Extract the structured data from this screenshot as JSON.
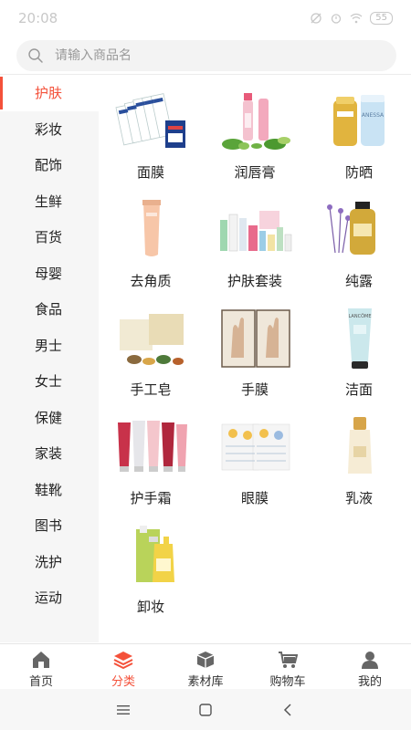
{
  "status_bar": {
    "time": "20:08",
    "battery": "55"
  },
  "search": {
    "placeholder": "请输入商品名"
  },
  "sidebar": {
    "items": [
      {
        "label": "护肤",
        "active": true
      },
      {
        "label": "彩妆"
      },
      {
        "label": "配饰"
      },
      {
        "label": "生鲜"
      },
      {
        "label": "百货"
      },
      {
        "label": "母婴"
      },
      {
        "label": "食品"
      },
      {
        "label": "男士"
      },
      {
        "label": "女士"
      },
      {
        "label": "保健"
      },
      {
        "label": "家装"
      },
      {
        "label": "鞋靴"
      },
      {
        "label": "图书"
      },
      {
        "label": "洗护"
      },
      {
        "label": "运动"
      }
    ]
  },
  "categories": [
    {
      "label": "面膜",
      "icon": "face-mask-product-image"
    },
    {
      "label": "润唇膏",
      "icon": "lip-balm-product-image"
    },
    {
      "label": "防晒",
      "icon": "sunscreen-product-image"
    },
    {
      "label": "去角质",
      "icon": "exfoliator-product-image"
    },
    {
      "label": "护肤套装",
      "icon": "skincare-set-product-image"
    },
    {
      "label": "纯露",
      "icon": "hydrosol-product-image"
    },
    {
      "label": "手工皂",
      "icon": "handmade-soap-product-image"
    },
    {
      "label": "手膜",
      "icon": "hand-mask-product-image"
    },
    {
      "label": "洁面",
      "icon": "cleanser-product-image"
    },
    {
      "label": "护手霜",
      "icon": "hand-cream-product-image"
    },
    {
      "label": "眼膜",
      "icon": "eye-mask-product-image"
    },
    {
      "label": "乳液",
      "icon": "lotion-product-image"
    },
    {
      "label": "卸妆",
      "icon": "makeup-remover-product-image"
    }
  ],
  "tabs": [
    {
      "label": "首页",
      "icon": "home-icon"
    },
    {
      "label": "分类",
      "icon": "category-layers-icon",
      "active": true
    },
    {
      "label": "素材库",
      "icon": "material-box-icon"
    },
    {
      "label": "购物车",
      "icon": "shopping-cart-icon"
    },
    {
      "label": "我的",
      "icon": "profile-icon"
    }
  ],
  "colors": {
    "accent": "#f4513a",
    "sidebar_bg": "#f6f6f6",
    "icon_gray": "#666666"
  }
}
